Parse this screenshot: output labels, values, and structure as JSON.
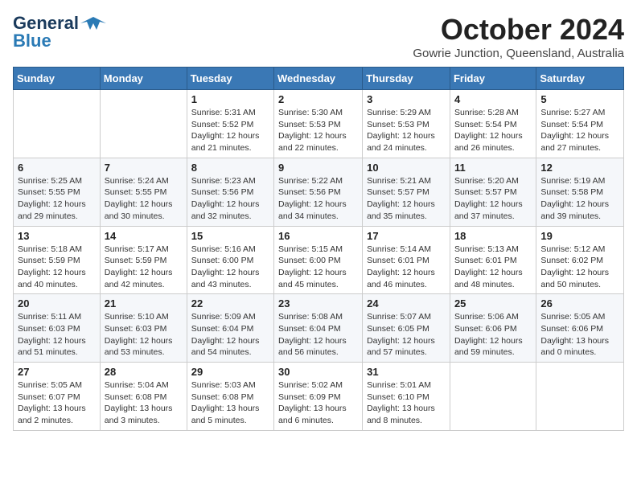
{
  "logo": {
    "line1": "General",
    "line2": "Blue"
  },
  "title": "October 2024",
  "location": "Gowrie Junction, Queensland, Australia",
  "days_of_week": [
    "Sunday",
    "Monday",
    "Tuesday",
    "Wednesday",
    "Thursday",
    "Friday",
    "Saturday"
  ],
  "weeks": [
    [
      {
        "day": "",
        "info": ""
      },
      {
        "day": "",
        "info": ""
      },
      {
        "day": "1",
        "info": "Sunrise: 5:31 AM\nSunset: 5:52 PM\nDaylight: 12 hours and 21 minutes."
      },
      {
        "day": "2",
        "info": "Sunrise: 5:30 AM\nSunset: 5:53 PM\nDaylight: 12 hours and 22 minutes."
      },
      {
        "day": "3",
        "info": "Sunrise: 5:29 AM\nSunset: 5:53 PM\nDaylight: 12 hours and 24 minutes."
      },
      {
        "day": "4",
        "info": "Sunrise: 5:28 AM\nSunset: 5:54 PM\nDaylight: 12 hours and 26 minutes."
      },
      {
        "day": "5",
        "info": "Sunrise: 5:27 AM\nSunset: 5:54 PM\nDaylight: 12 hours and 27 minutes."
      }
    ],
    [
      {
        "day": "6",
        "info": "Sunrise: 5:25 AM\nSunset: 5:55 PM\nDaylight: 12 hours and 29 minutes."
      },
      {
        "day": "7",
        "info": "Sunrise: 5:24 AM\nSunset: 5:55 PM\nDaylight: 12 hours and 30 minutes."
      },
      {
        "day": "8",
        "info": "Sunrise: 5:23 AM\nSunset: 5:56 PM\nDaylight: 12 hours and 32 minutes."
      },
      {
        "day": "9",
        "info": "Sunrise: 5:22 AM\nSunset: 5:56 PM\nDaylight: 12 hours and 34 minutes."
      },
      {
        "day": "10",
        "info": "Sunrise: 5:21 AM\nSunset: 5:57 PM\nDaylight: 12 hours and 35 minutes."
      },
      {
        "day": "11",
        "info": "Sunrise: 5:20 AM\nSunset: 5:57 PM\nDaylight: 12 hours and 37 minutes."
      },
      {
        "day": "12",
        "info": "Sunrise: 5:19 AM\nSunset: 5:58 PM\nDaylight: 12 hours and 39 minutes."
      }
    ],
    [
      {
        "day": "13",
        "info": "Sunrise: 5:18 AM\nSunset: 5:59 PM\nDaylight: 12 hours and 40 minutes."
      },
      {
        "day": "14",
        "info": "Sunrise: 5:17 AM\nSunset: 5:59 PM\nDaylight: 12 hours and 42 minutes."
      },
      {
        "day": "15",
        "info": "Sunrise: 5:16 AM\nSunset: 6:00 PM\nDaylight: 12 hours and 43 minutes."
      },
      {
        "day": "16",
        "info": "Sunrise: 5:15 AM\nSunset: 6:00 PM\nDaylight: 12 hours and 45 minutes."
      },
      {
        "day": "17",
        "info": "Sunrise: 5:14 AM\nSunset: 6:01 PM\nDaylight: 12 hours and 46 minutes."
      },
      {
        "day": "18",
        "info": "Sunrise: 5:13 AM\nSunset: 6:01 PM\nDaylight: 12 hours and 48 minutes."
      },
      {
        "day": "19",
        "info": "Sunrise: 5:12 AM\nSunset: 6:02 PM\nDaylight: 12 hours and 50 minutes."
      }
    ],
    [
      {
        "day": "20",
        "info": "Sunrise: 5:11 AM\nSunset: 6:03 PM\nDaylight: 12 hours and 51 minutes."
      },
      {
        "day": "21",
        "info": "Sunrise: 5:10 AM\nSunset: 6:03 PM\nDaylight: 12 hours and 53 minutes."
      },
      {
        "day": "22",
        "info": "Sunrise: 5:09 AM\nSunset: 6:04 PM\nDaylight: 12 hours and 54 minutes."
      },
      {
        "day": "23",
        "info": "Sunrise: 5:08 AM\nSunset: 6:04 PM\nDaylight: 12 hours and 56 minutes."
      },
      {
        "day": "24",
        "info": "Sunrise: 5:07 AM\nSunset: 6:05 PM\nDaylight: 12 hours and 57 minutes."
      },
      {
        "day": "25",
        "info": "Sunrise: 5:06 AM\nSunset: 6:06 PM\nDaylight: 12 hours and 59 minutes."
      },
      {
        "day": "26",
        "info": "Sunrise: 5:05 AM\nSunset: 6:06 PM\nDaylight: 13 hours and 0 minutes."
      }
    ],
    [
      {
        "day": "27",
        "info": "Sunrise: 5:05 AM\nSunset: 6:07 PM\nDaylight: 13 hours and 2 minutes."
      },
      {
        "day": "28",
        "info": "Sunrise: 5:04 AM\nSunset: 6:08 PM\nDaylight: 13 hours and 3 minutes."
      },
      {
        "day": "29",
        "info": "Sunrise: 5:03 AM\nSunset: 6:08 PM\nDaylight: 13 hours and 5 minutes."
      },
      {
        "day": "30",
        "info": "Sunrise: 5:02 AM\nSunset: 6:09 PM\nDaylight: 13 hours and 6 minutes."
      },
      {
        "day": "31",
        "info": "Sunrise: 5:01 AM\nSunset: 6:10 PM\nDaylight: 13 hours and 8 minutes."
      },
      {
        "day": "",
        "info": ""
      },
      {
        "day": "",
        "info": ""
      }
    ]
  ]
}
